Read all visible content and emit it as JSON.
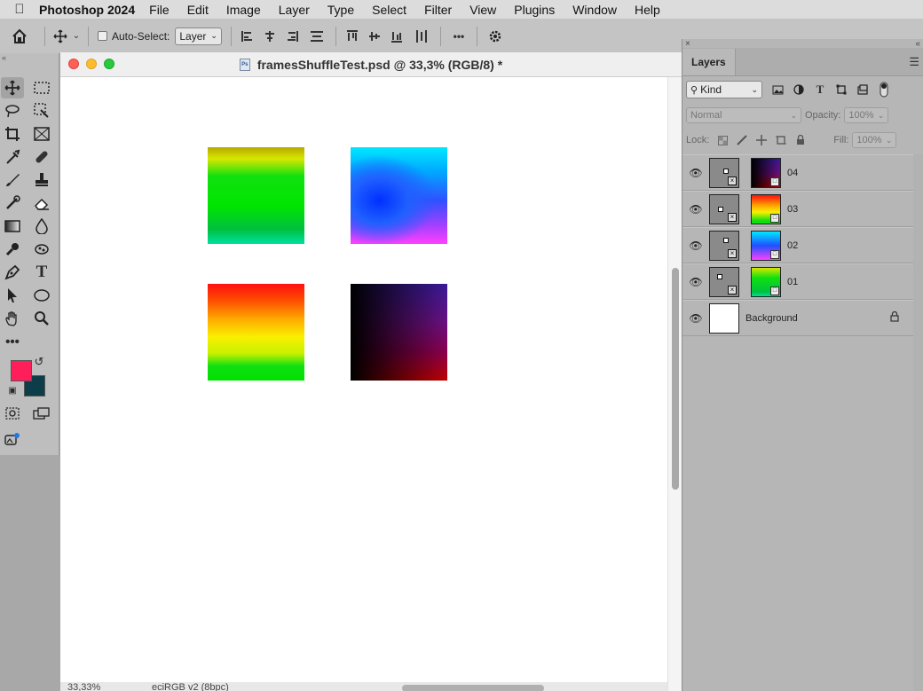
{
  "menubar": {
    "app_name": "Photoshop 2024",
    "items": [
      "File",
      "Edit",
      "Image",
      "Layer",
      "Type",
      "Select",
      "Filter",
      "View",
      "Plugins",
      "Window",
      "Help"
    ]
  },
  "options_bar": {
    "auto_select_label": "Auto-Select:",
    "auto_select_checked": false,
    "auto_select_target": "Layer",
    "more_label": "•••"
  },
  "tools": {
    "active": "move-tool",
    "foreground_color": "#fe1e5a",
    "background_color": "#0e3d4a"
  },
  "document": {
    "title": "framesShuffleTest.psd @ 33,3% (RGB/8) *",
    "zoom": "33,33%",
    "profile": "eciRGB v2 (8bpc)"
  },
  "canvas_squares": [
    {
      "name": "square-01",
      "colors": [
        "yellow-to-green",
        "#e8f000",
        "#00e600",
        "#00b96a"
      ]
    },
    {
      "name": "square-02",
      "colors": [
        "cyan-to-blue-to-magenta",
        "#00e0ff",
        "#0040ff",
        "#ff40ff"
      ]
    },
    {
      "name": "square-03",
      "colors": [
        "red-to-yellow-to-green",
        "#ff2020",
        "#f8f000",
        "#10e010"
      ]
    },
    {
      "name": "square-04",
      "colors": [
        "black-to-purple-to-red",
        "#000000",
        "#7a1070",
        "#c00000"
      ]
    }
  ],
  "layers_panel": {
    "tab": "Layers",
    "filter_kind": "Kind",
    "blend_mode": "Normal",
    "opacity_label": "Opacity:",
    "opacity_value": "100%",
    "lock_label": "Lock:",
    "fill_label": "Fill:",
    "fill_value": "100%",
    "layers": [
      {
        "name": "04",
        "visible": true,
        "thumb": "dark-purple-red"
      },
      {
        "name": "03",
        "visible": true,
        "thumb": "red-yellow-green"
      },
      {
        "name": "02",
        "visible": true,
        "thumb": "cyan-blue-magenta"
      },
      {
        "name": "01",
        "visible": true,
        "thumb": "yellow-green"
      },
      {
        "name": "Background",
        "visible": true,
        "thumb": "white",
        "locked": true
      }
    ]
  }
}
